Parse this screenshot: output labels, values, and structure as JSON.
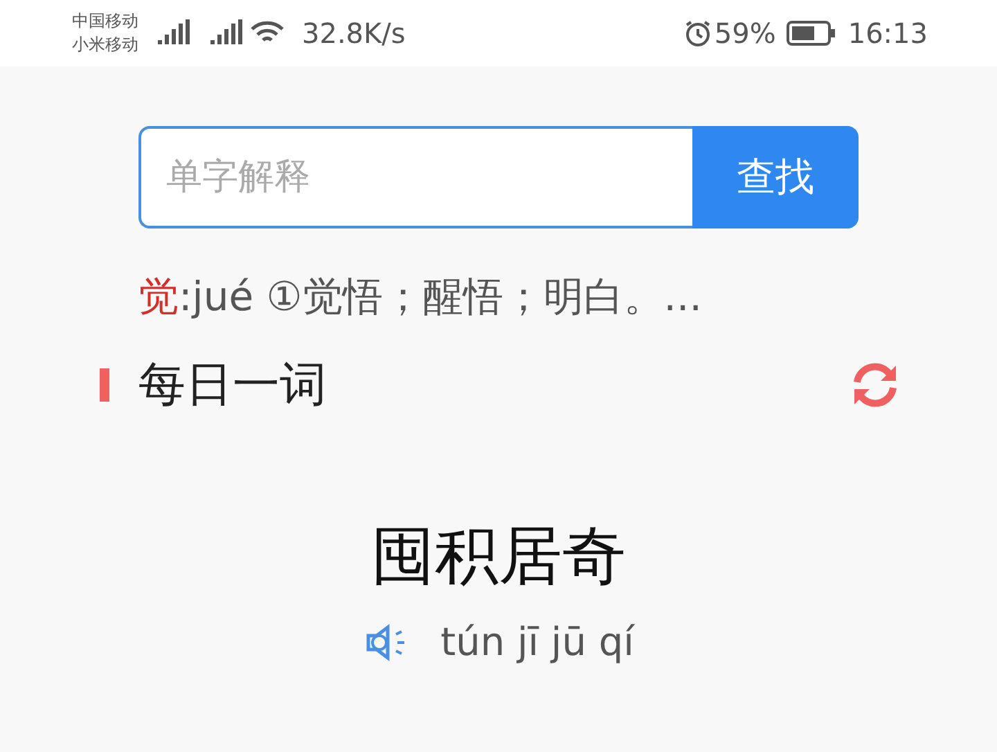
{
  "status_bar": {
    "carriers": [
      "中国移动",
      "小米移动"
    ],
    "speed": "32.8K/s",
    "battery": "59%",
    "time": "16:13"
  },
  "search": {
    "placeholder": "单字解释",
    "button": "查找"
  },
  "definition": {
    "headword": "觉",
    "text": ":jué ①觉悟；醒悟；明白。..."
  },
  "daily_word": {
    "title": "每日一词",
    "word": "囤积居奇",
    "pinyin": "tún jī jū qí"
  }
}
